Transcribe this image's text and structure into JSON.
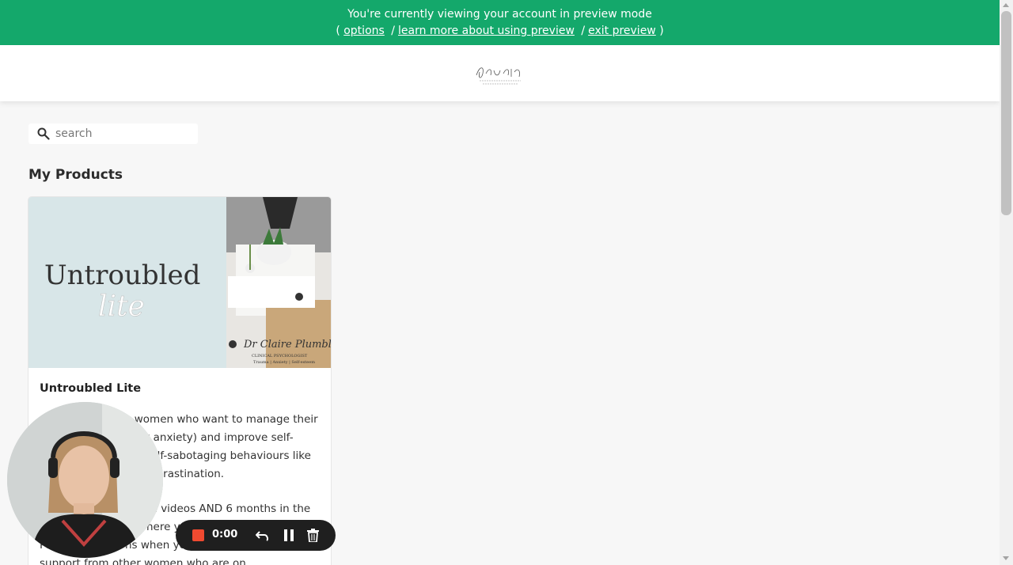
{
  "preview_bar": {
    "message": "You're currently viewing your account in preview mode",
    "open_paren": "(",
    "close_paren": ")",
    "separator": "/",
    "options_link": "options",
    "learn_more_link": "learn more about using preview",
    "exit_link": "exit preview",
    "background": "#14a86b"
  },
  "header": {
    "logo_icon": "dr-claire-plumbly-logo"
  },
  "search": {
    "placeholder": "search",
    "icon": "search-icon"
  },
  "products_section": {
    "title": "My Products"
  },
  "products": [
    {
      "title": "Untroubled Lite",
      "image_icon": "untroubled-lite-cover-image",
      "description": [
        "A programme for women who want to manage their emotions (especially anxiety) and improve self-esteem by tackling self-sabotaging behaviours like perfectionism and procrastination.",
        "Lifetime access to the videos AND 6 months in the community group where you can ask Dr Claire Plumbly questions when you get stuck and get support from other women who are on"
      ]
    }
  ],
  "webcam": {
    "icon": "webcam-presenter-image"
  },
  "recorder": {
    "time": "0:00",
    "stop_color": "#f04a30"
  }
}
